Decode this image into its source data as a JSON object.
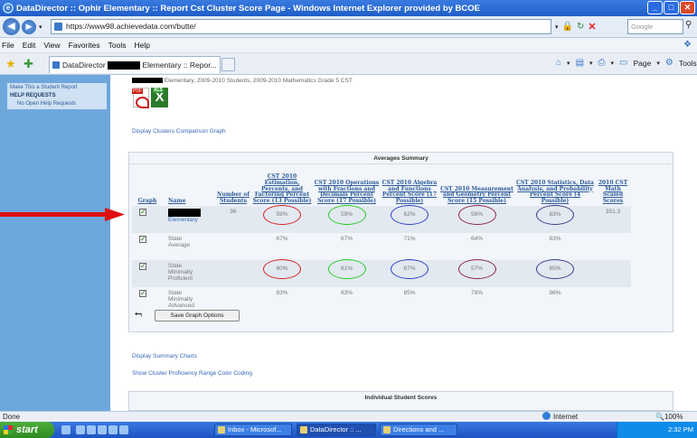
{
  "window": {
    "title": "DataDirector :: Ophir Elementary :: Report Cst Cluster Score Page - Windows Internet Explorer provided by BCOE",
    "controls": [
      "_",
      "□",
      "✕"
    ]
  },
  "address_bar": {
    "url": "https://www98.achievedata.com/butte/",
    "search_placeholder": "Google"
  },
  "menu": [
    "File",
    "Edit",
    "View",
    "Favorites",
    "Tools",
    "Help"
  ],
  "tab": {
    "label_prefix": "DataDirector",
    "label_suffix": "Elementary :: Repor..."
  },
  "command_bar": {
    "page": "Page",
    "tools": "Tools"
  },
  "sidebar": {
    "links": [
      {
        "text": "Make This a Student Report",
        "kind": "link"
      },
      {
        "text": "HELP REQUESTS",
        "kind": "header"
      },
      {
        "text": "No Open Help Requests",
        "kind": "sub"
      }
    ]
  },
  "main": {
    "breadcrumb_suffix": "Elementary, 2009-2010 Students, 2009-2010 Mathematics Grade 5 CST",
    "export_icons": {
      "pdf_tag": "PDF",
      "xls_tag": "XLS",
      "xls_glyph": "X"
    },
    "clusters_link": "Display Clusters Comparison Graph",
    "averages_title": "Averages Summary",
    "columns": [
      "Graph",
      "Name",
      "Number of Students",
      "CST 2010 Estimation, Percents, and Factoring Percent Score (13 Possible)",
      "CST 2010 Operations with Fractions and Decimals Percent Score (17 Possible)",
      "CST 2010 Algebra and Functions Percent Score (17 Possible)",
      "CST 2010 Measurement and Geometry Percent Score (15 Possible)",
      "CST 2010 Statistics, Data Analysis, and Probability Percent Score (4 Possible)",
      "2010 CST Math Scaled Scores"
    ],
    "rows": [
      {
        "name": "Elementary",
        "students": "96",
        "v1": "59%",
        "v2": "59%",
        "v3": "62%",
        "v4": "59%",
        "v5": "83%",
        "scaled": "351.3",
        "circled": true
      },
      {
        "name": "State Average",
        "students": "",
        "v1": "67%",
        "v2": "67%",
        "v3": "71%",
        "v4": "64%",
        "v5": "83%",
        "scaled": "",
        "circled": false
      },
      {
        "name": "State Minimally Proficient",
        "students": "",
        "v1": "60%",
        "v2": "61%",
        "v3": "67%",
        "v4": "57%",
        "v5": "85%",
        "scaled": "",
        "circled": true
      },
      {
        "name": "State Minimally Advanced",
        "students": "",
        "v1": "83%",
        "v2": "83%",
        "v3": "85%",
        "v4": "78%",
        "v5": "96%",
        "scaled": "",
        "circled": false
      }
    ],
    "ring_colors": [
      "#d42020",
      "#22cc22",
      "#2a3fc8",
      "#8a1f4a",
      "#3a3a8a"
    ],
    "save_button": "Save Graph Options",
    "summary_charts_link": "Display Summary Charts",
    "color_coding_link": "Show Cluster Proficiency Range Color Coding",
    "individual_title": "Individual Student Scores"
  },
  "status_bar": {
    "left": "Done",
    "zone": "Internet",
    "zoom": "100%"
  },
  "taskbar": {
    "start": "start",
    "items": [
      "Inbox - Microsof...",
      "DataDirector :: ...",
      "Directions and ..."
    ],
    "clock": "2:32 PM"
  }
}
